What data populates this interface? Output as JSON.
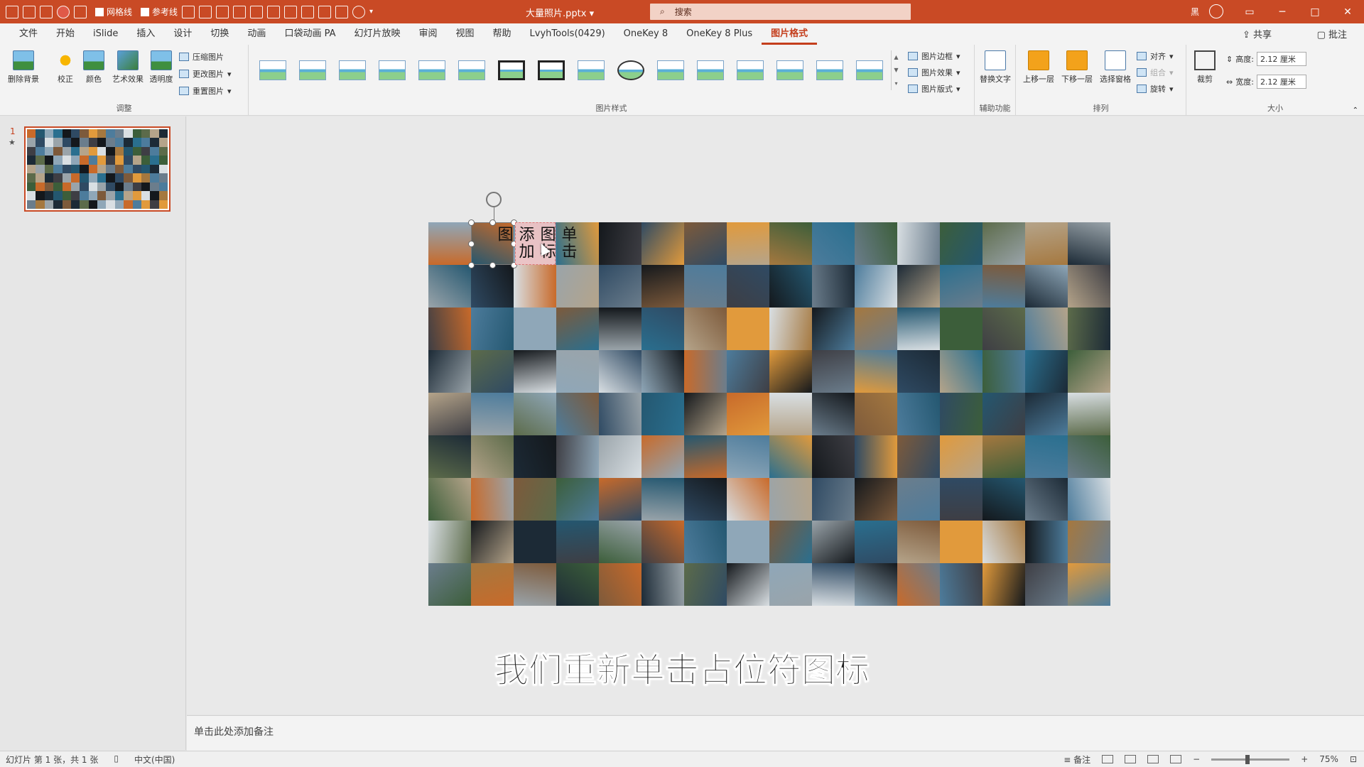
{
  "titlebar": {
    "doc_title": "大量照片.pptx",
    "gridlines_label": "网格线",
    "guides_label": "参考线",
    "search_placeholder": "搜索",
    "user_label": "黑"
  },
  "menu": {
    "tabs": [
      "文件",
      "开始",
      "iSlide",
      "插入",
      "设计",
      "切换",
      "动画",
      "口袋动画 PA",
      "幻灯片放映",
      "审阅",
      "视图",
      "帮助",
      "LvyhTools(0429)",
      "OneKey 8",
      "OneKey 8 Plus",
      "图片格式"
    ],
    "active_tab": "图片格式",
    "share": "共享",
    "comment": "批注"
  },
  "ribbon": {
    "adjust": {
      "remove_bg": "删除背景",
      "correct": "校正",
      "color": "颜色",
      "art_effects": "艺术效果",
      "transparency": "透明度",
      "compress": "压缩图片",
      "change": "更改图片",
      "reset": "重置图片",
      "label": "调整"
    },
    "styles": {
      "label": "图片样式",
      "border": "图片边框",
      "effects": "图片效果",
      "layout": "图片版式"
    },
    "accessibility": {
      "alt_text": "替换文字",
      "label": "辅助功能"
    },
    "arrange": {
      "bring_forward": "上移一层",
      "send_backward": "下移一层",
      "selection_pane": "选择窗格",
      "align": "对齐",
      "group": "组合",
      "rotate": "旋转",
      "label": "排列"
    },
    "size": {
      "crop": "裁剪",
      "height_label": "高度:",
      "height_value": "2.12 厘米",
      "width_label": "宽度:",
      "width_value": "2.12 厘米",
      "label": "大小"
    }
  },
  "thumbs": {
    "slide_number": "1",
    "star": "★"
  },
  "canvas": {
    "placeholder_text": "单击图标添加图",
    "subtitle": "我们重新单击占位符图标"
  },
  "notes": {
    "placeholder": "单击此处添加备注"
  },
  "status": {
    "slide_info": "幻灯片 第 1 张，共 1 张",
    "language": "中文(中国)",
    "notes_btn": "备注",
    "zoom": "75%"
  }
}
